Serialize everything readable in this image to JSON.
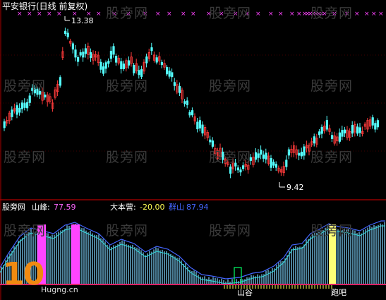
{
  "main_panel": {
    "title": "平安银行(日线 前复权)",
    "high_label": "13.38",
    "low_label": "9.42",
    "colors": {
      "up": "#ff3b3b",
      "down": "#54ffff",
      "marker": "#ff44ff",
      "title": "#ffffff"
    }
  },
  "indicator_panel": {
    "site_label": "股旁网",
    "peak_label": "山峰:",
    "peak_value": "77.59",
    "camp_label": "大本营:",
    "camp_value": "-20.00",
    "group_label": "群山",
    "group_value": "87.94",
    "valley_label": "山谷",
    "run_label": "跑吧",
    "colors": {
      "peak": "#ff44ff",
      "camp": "#ffff55",
      "group": "#4466ff",
      "valley": "#00ff66",
      "bars": "#7fd4ff"
    }
  },
  "watermark": {
    "text": "股旁网"
  },
  "logo": {
    "number": "10",
    "site": "Hugng.cn"
  },
  "chart_data": {
    "type": "candlestick",
    "title": "平安银行(日线 前复权)",
    "annotations": [
      {
        "label": "13.38",
        "kind": "high"
      },
      {
        "label": "9.42",
        "kind": "low"
      }
    ],
    "indicator": {
      "peak": 77.59,
      "camp": -20.0,
      "group": 87.94
    }
  }
}
